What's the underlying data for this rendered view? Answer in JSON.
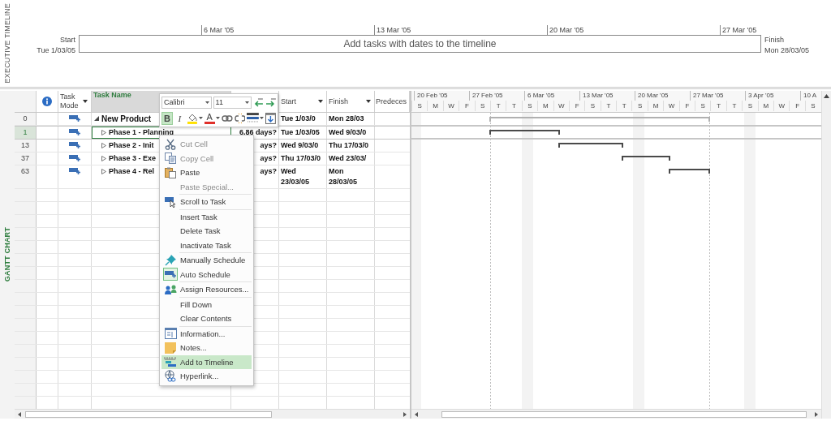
{
  "timeline": {
    "side_label": "EXECUTIVE TIMELINE",
    "start_label": "Start",
    "start_date": "Tue 1/03/05",
    "ticks": [
      "6 Mar '05",
      "13 Mar '05",
      "20 Mar '05",
      "27 Mar '05"
    ],
    "placeholder": "Add tasks with dates to the timeline",
    "finish_label": "Finish",
    "finish_date": "Mon 28/03/05"
  },
  "view_label": "GANTT CHART",
  "table": {
    "columns": [
      {
        "kind": "info",
        "selected": false
      },
      {
        "kind": "mode",
        "label": "Task Mode",
        "selected": false,
        "filter": true
      },
      {
        "kind": "name",
        "label": "Task Name",
        "selected": true,
        "filter": false
      },
      {
        "kind": "duration",
        "selected": false
      },
      {
        "kind": "start",
        "label": "Start",
        "selected": false,
        "filter": true
      },
      {
        "kind": "finish",
        "label": "Finish",
        "selected": false,
        "filter": true
      },
      {
        "kind": "predecessors",
        "label": "Predeces",
        "selected": false
      }
    ],
    "tasks": [
      {
        "id": "0",
        "name": "New Product",
        "start": "Tue 1/03/0",
        "finish": "Mon 28/03",
        "selected": false,
        "expanded": true,
        "children": [
          {
            "id": "1",
            "name": "Phase 1 - Planning",
            "duration": "6.86 days?",
            "start": "Tue 1/03/05",
            "finish": "Wed 9/03/0",
            "selected": true,
            "expanded": false
          },
          {
            "id": "13",
            "name": "Phase 2 - Init",
            "duration": "ays?",
            "start": "Wed 9/03/0",
            "finish": "Thu 17/03/0",
            "selected": false,
            "expanded": false
          },
          {
            "id": "37",
            "name": "Phase 3 - Exe",
            "duration": "ays?",
            "start": "Thu 17/03/0",
            "finish": "Wed 23/03/",
            "selected": false,
            "expanded": false
          },
          {
            "id": "63",
            "name": "Phase 4 - Rel",
            "duration": "ays?",
            "start": "Wed 23/03/05",
            "finish": "Mon 28/03/05",
            "selected": false,
            "expanded": false
          }
        ]
      }
    ]
  },
  "gantt": {
    "weeks": [
      "20 Feb '05",
      "27 Feb '05",
      "6 Mar '05",
      "13 Mar '05",
      "20 Mar '05",
      "27 Mar '05",
      "3 Apr '05",
      "10 A"
    ],
    "days": [
      "S",
      "M",
      "W",
      "F",
      "S",
      "T",
      "T",
      "S",
      "M",
      "W",
      "F",
      "S",
      "T",
      "T",
      "S",
      "M",
      "W",
      "F",
      "S",
      "T",
      "T",
      "S",
      "M",
      "W",
      "F",
      "S"
    ]
  },
  "mini_toolbar": {
    "font": "Calibri",
    "size": "11",
    "bold": {
      "label": "B",
      "on": true
    },
    "italic": {
      "label": "I",
      "on": false
    },
    "font_color": {
      "label": "A"
    }
  },
  "menu": {
    "groups": [
      [
        {
          "label": "Cut Cell",
          "disabled": true,
          "selected": false,
          "checked": false
        },
        {
          "label": "Copy Cell",
          "disabled": true,
          "selected": false,
          "checked": false
        },
        {
          "label": "Paste",
          "disabled": false,
          "selected": false,
          "checked": false
        },
        {
          "label": "Paste Special...",
          "disabled": true,
          "selected": false,
          "checked": false
        }
      ],
      [
        {
          "label": "Scroll to Task",
          "disabled": false,
          "selected": false,
          "checked": false
        }
      ],
      [
        {
          "label": "Insert Task",
          "disabled": false,
          "selected": false,
          "checked": false
        },
        {
          "label": "Delete Task",
          "disabled": false,
          "selected": false,
          "checked": false
        },
        {
          "label": "Inactivate Task",
          "disabled": false,
          "selected": false,
          "checked": false
        }
      ],
      [
        {
          "label": "Manually Schedule",
          "disabled": false,
          "selected": false,
          "checked": false
        },
        {
          "label": "Auto Schedule",
          "disabled": false,
          "selected": false,
          "checked": true
        }
      ],
      [
        {
          "label": "Assign Resources...",
          "disabled": false,
          "selected": false,
          "checked": false
        }
      ],
      [
        {
          "label": "Fill Down",
          "disabled": false,
          "selected": false,
          "checked": false
        },
        {
          "label": "Clear Contents",
          "disabled": false,
          "selected": false,
          "checked": false
        }
      ],
      [
        {
          "label": "Information...",
          "disabled": false,
          "selected": false,
          "checked": false
        },
        {
          "label": "Notes...",
          "disabled": false,
          "selected": false,
          "checked": false
        },
        {
          "label": "Add to Timeline",
          "disabled": false,
          "selected": true,
          "checked": false
        },
        {
          "label": "Hyperlink...",
          "disabled": false,
          "selected": false,
          "checked": false
        }
      ]
    ]
  }
}
